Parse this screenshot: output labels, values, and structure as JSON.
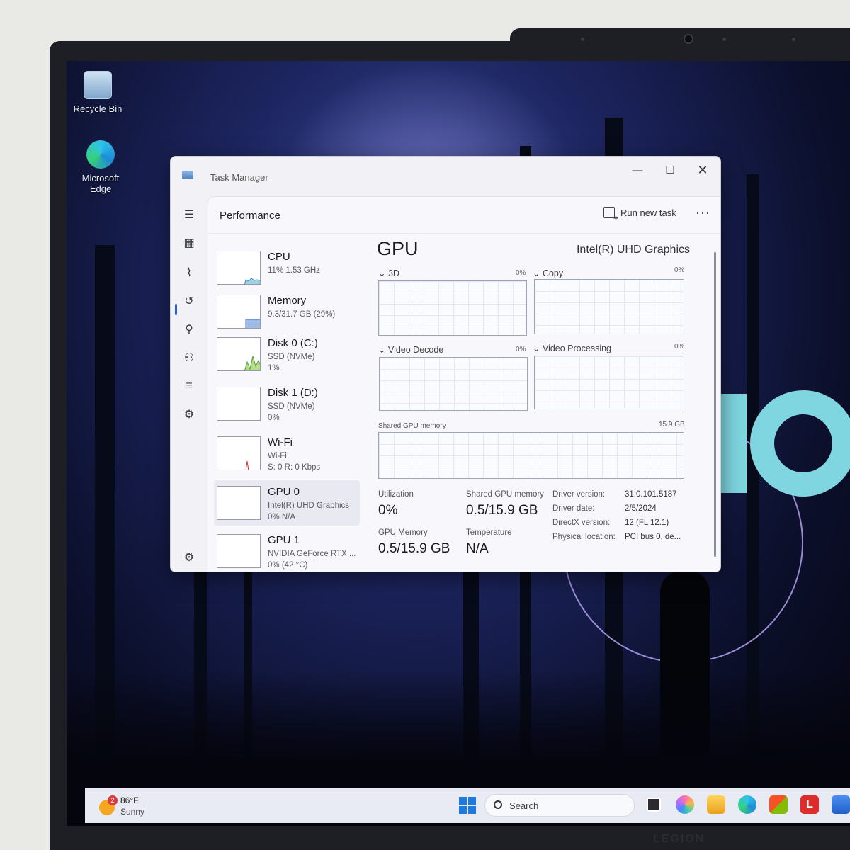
{
  "desktop": {
    "icons": [
      {
        "label": "Recycle Bin",
        "icon": "recycle-bin-icon"
      },
      {
        "label": "Microsoft Edge",
        "icon": "edge-icon"
      }
    ]
  },
  "task_manager": {
    "title": "Task Manager",
    "page_title": "Performance",
    "run_new_task": "Run new task",
    "more": "···",
    "window_buttons": {
      "minimize": "—",
      "maximize": "☐",
      "close": "✕"
    },
    "devices": [
      {
        "name": "CPU",
        "sub1": "11%  1.53 GHz",
        "sub2": ""
      },
      {
        "name": "Memory",
        "sub1": "9.3/31.7 GB (29%)",
        "sub2": ""
      },
      {
        "name": "Disk 0 (C:)",
        "sub1": "SSD (NVMe)",
        "sub2": "1%"
      },
      {
        "name": "Disk 1 (D:)",
        "sub1": "SSD (NVMe)",
        "sub2": "0%"
      },
      {
        "name": "Wi-Fi",
        "sub1": "Wi-Fi",
        "sub2": "S: 0  R: 0 Kbps"
      },
      {
        "name": "GPU 0",
        "sub1": "Intel(R) UHD Graphics",
        "sub2": "0%  N/A"
      },
      {
        "name": "GPU 1",
        "sub1": "NVIDIA GeForce RTX ...",
        "sub2": "0%  (42 °C)"
      }
    ],
    "selected_device": "GPU 0",
    "detail": {
      "title": "GPU",
      "model": "Intel(R) UHD Graphics",
      "engines": [
        {
          "label": "3D",
          "pct": "0%"
        },
        {
          "label": "Copy",
          "pct": "0%"
        },
        {
          "label": "Video Decode",
          "pct": "0%"
        },
        {
          "label": "Video Processing",
          "pct": "0%"
        }
      ],
      "shared_graph_label": "Shared GPU memory",
      "shared_graph_max": "15.9 GB",
      "stats": {
        "utilization_label": "Utilization",
        "utilization_value": "0%",
        "shared_mem_label": "Shared GPU memory",
        "shared_mem_value": "0.5/15.9 GB",
        "gpu_mem_label": "GPU Memory",
        "gpu_mem_value": "0.5/15.9 GB",
        "temp_label": "Temperature",
        "temp_value": "N/A"
      },
      "info": [
        {
          "key": "Driver version:",
          "value": "31.0.101.5187"
        },
        {
          "key": "Driver date:",
          "value": "2/5/2024"
        },
        {
          "key": "DirectX version:",
          "value": "12 (FL 12.1)"
        },
        {
          "key": "Physical location:",
          "value": "PCI bus 0, de..."
        }
      ]
    }
  },
  "taskbar": {
    "weather_temp": "86°F",
    "weather_cond": "Sunny",
    "weather_badge": "2",
    "search_placeholder": "Search",
    "pinned": [
      "task-view-icon",
      "copilot-icon",
      "file-explorer-icon",
      "edge-icon",
      "store-icon",
      "lenovo-l-icon",
      "app-icon"
    ]
  },
  "hardware_label": "LEGION"
}
